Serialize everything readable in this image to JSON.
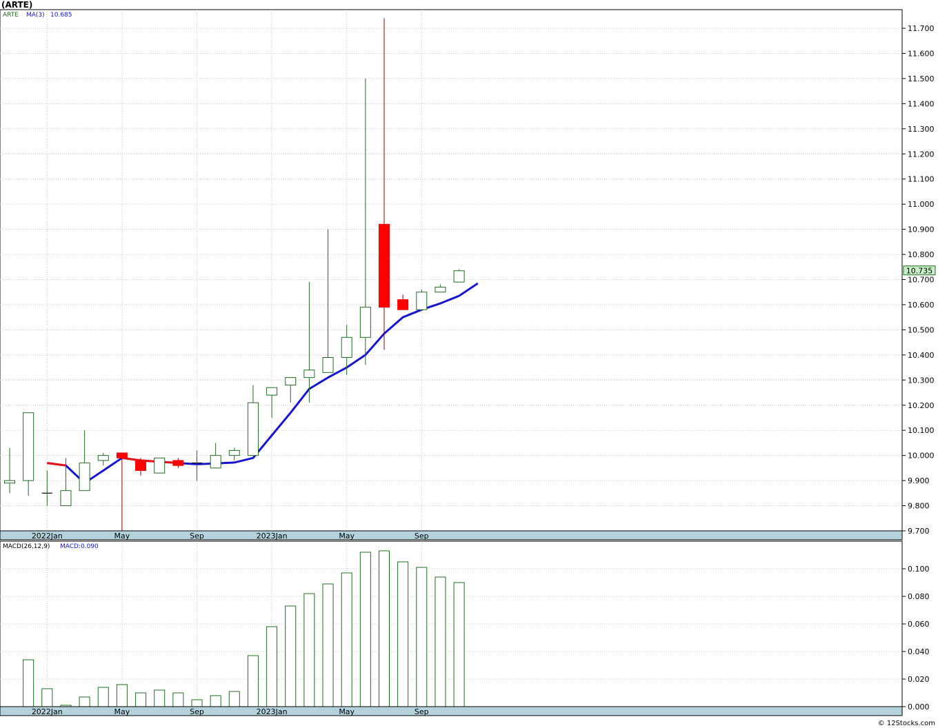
{
  "symbol_title": "(ARTE)",
  "legend": {
    "symbol": "ARTE",
    "ma_label": "MA(3)",
    "ma_value": "10.685",
    "macd_label": "MACD(26,12,9)",
    "macd_value": "MACD:0.090"
  },
  "last_price_tag": "10.735",
  "footer": "© 12Stocks.com",
  "colors": {
    "up": "#1e6b1e",
    "down": "#ff0000",
    "ma_blue": "#1414d2",
    "ma_red": "#ee1111",
    "grid": "#c0c0c0",
    "axis_band": "#b4d2dc",
    "price_tag_bg": "#c8f0c8"
  },
  "chart_data": [
    {
      "type": "candlestick",
      "title": "(ARTE)",
      "period": "monthly",
      "ylim": [
        9.7,
        11.75
      ],
      "y_ticks": [
        "9.700",
        "9.800",
        "9.900",
        "10.000",
        "10.100",
        "10.200",
        "10.300",
        "10.400",
        "10.500",
        "10.600",
        "10.700",
        "10.800",
        "10.900",
        "11.000",
        "11.100",
        "11.200",
        "11.300",
        "11.400",
        "11.500",
        "11.600",
        "11.700"
      ],
      "x_labels": [
        "2022Jan",
        "May",
        "Sep",
        "2023Jan",
        "May",
        "Sep"
      ],
      "x_label_index": [
        2,
        6,
        10,
        14,
        18,
        22
      ],
      "candles": [
        {
          "o": 9.89,
          "h": 10.03,
          "l": 9.85,
          "c": 9.9
        },
        {
          "o": 9.9,
          "h": 10.17,
          "l": 9.84,
          "c": 10.17
        },
        {
          "o": 9.85,
          "h": 9.94,
          "l": 9.8,
          "c": 9.85
        },
        {
          "o": 9.8,
          "h": 9.99,
          "l": 9.8,
          "c": 9.86
        },
        {
          "o": 9.86,
          "h": 10.1,
          "l": 9.86,
          "c": 9.97
        },
        {
          "o": 9.98,
          "h": 10.01,
          "l": 9.96,
          "c": 10.0
        },
        {
          "o": 10.01,
          "h": 10.01,
          "l": 9.7,
          "c": 9.99
        },
        {
          "o": 9.98,
          "h": 9.99,
          "l": 9.92,
          "c": 9.94
        },
        {
          "o": 9.93,
          "h": 9.99,
          "l": 9.93,
          "c": 9.99
        },
        {
          "o": 9.98,
          "h": 9.99,
          "l": 9.95,
          "c": 9.96
        },
        {
          "o": 9.97,
          "h": 10.02,
          "l": 9.9,
          "c": 9.97
        },
        {
          "o": 9.95,
          "h": 10.05,
          "l": 9.95,
          "c": 10.0
        },
        {
          "o": 10.0,
          "h": 10.03,
          "l": 9.98,
          "c": 10.02
        },
        {
          "o": 10.0,
          "h": 10.28,
          "l": 10.0,
          "c": 10.21
        },
        {
          "o": 10.24,
          "h": 10.27,
          "l": 10.15,
          "c": 10.27
        },
        {
          "o": 10.28,
          "h": 10.31,
          "l": 10.21,
          "c": 10.31
        },
        {
          "o": 10.31,
          "h": 10.69,
          "l": 10.21,
          "c": 10.34
        },
        {
          "o": 10.33,
          "h": 10.9,
          "l": 10.33,
          "c": 10.39
        },
        {
          "o": 10.39,
          "h": 10.52,
          "l": 10.32,
          "c": 10.47
        },
        {
          "o": 10.47,
          "h": 11.5,
          "l": 10.36,
          "c": 10.59
        },
        {
          "o": 10.92,
          "h": 11.74,
          "l": 10.42,
          "c": 10.59
        },
        {
          "o": 10.62,
          "h": 10.64,
          "l": 10.58,
          "c": 10.58
        },
        {
          "o": 10.58,
          "h": 10.66,
          "l": 10.58,
          "c": 10.65
        },
        {
          "o": 10.65,
          "h": 10.68,
          "l": 10.65,
          "c": 10.67
        },
        {
          "o": 10.69,
          "h": 10.74,
          "l": 10.69,
          "c": 10.735
        }
      ],
      "ma3": {
        "name": "MA(3)",
        "start_index": 2,
        "values": [
          9.97,
          9.96,
          9.89,
          9.94,
          9.99,
          9.98,
          9.975,
          9.97,
          9.965,
          9.968,
          9.972,
          9.99,
          10.08,
          10.17,
          10.265,
          10.31,
          10.35,
          10.4,
          10.485,
          10.55,
          10.58,
          10.605,
          10.635,
          10.685
        ],
        "red_until_index": 9
      },
      "last_value": 10.735
    },
    {
      "type": "bar",
      "title": "MACD(26,12,9)",
      "ylim": [
        0,
        0.12
      ],
      "y_ticks": [
        "0.000",
        "0.020",
        "0.040",
        "0.060",
        "0.080",
        "0.100"
      ],
      "x_labels": [
        "2022Jan",
        "May",
        "Sep",
        "2023Jan",
        "May",
        "Sep"
      ],
      "x_label_index": [
        2,
        6,
        10,
        14,
        18,
        22
      ],
      "values": [
        0.0,
        0.034,
        0.013,
        0.001,
        0.007,
        0.014,
        0.016,
        0.01,
        0.012,
        0.01,
        0.005,
        0.008,
        0.011,
        0.037,
        0.058,
        0.073,
        0.082,
        0.089,
        0.097,
        0.112,
        0.113,
        0.105,
        0.101,
        0.094,
        0.09
      ]
    }
  ]
}
